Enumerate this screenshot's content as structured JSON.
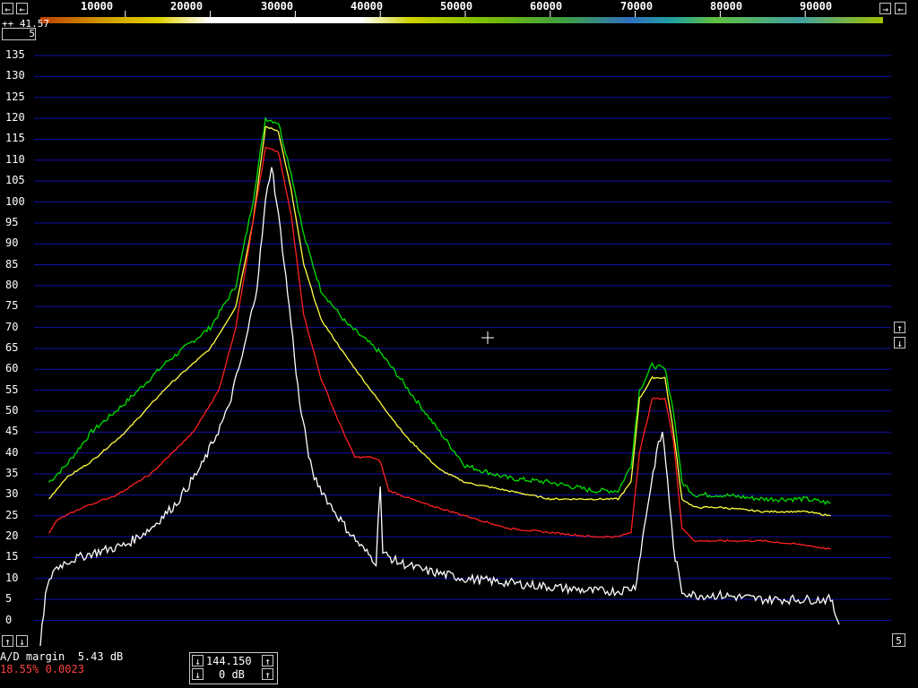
{
  "top_bar": {
    "freq_labels": [
      "10000",
      "20000",
      "30000",
      "40000",
      "50000",
      "60000",
      "70000",
      "80000",
      "90000"
    ],
    "left_arrow": "←",
    "right_arrow": "→"
  },
  "header_small": {
    "readout": "++ 41.57",
    "box": "5"
  },
  "side_controls": {
    "up": "↑",
    "down": "↓",
    "right_box": "5"
  },
  "bottom_left": {
    "ad_margin_label": "A/D margin  5.43 dB",
    "status_red": "18.55% 0.0023"
  },
  "center_box": {
    "freq": "144.150",
    "gain": "0 dB"
  },
  "colors": {
    "green": "#00e000",
    "yellow": "#ffff40",
    "red": "#ff2020",
    "white": "#ffffff",
    "grid": "#1010a8"
  },
  "chart_data": {
    "type": "line",
    "ylim": [
      -5,
      138
    ],
    "xlim": [
      0,
      100000
    ],
    "ylabel": "",
    "xlabel": "",
    "y_ticks": [
      135,
      130,
      125,
      120,
      115,
      110,
      105,
      100,
      95,
      90,
      85,
      80,
      75,
      70,
      65,
      60,
      55,
      50,
      45,
      40,
      35,
      30,
      25,
      20,
      15,
      10,
      5,
      0
    ],
    "x_ticks": [
      10000,
      20000,
      30000,
      40000,
      50000,
      60000,
      70000,
      80000,
      90000
    ],
    "series": [
      {
        "color": "#00e000",
        "x": [
          1000,
          3000,
          6000,
          10000,
          15000,
          20000,
          23000,
          25000,
          26500,
          28000,
          29500,
          31000,
          33000,
          36000,
          40000,
          43000,
          47000,
          50000,
          55000,
          60000,
          65000,
          68000,
          69500,
          70500,
          72000,
          73500,
          74500,
          75500,
          77000,
          80000,
          85000,
          90000,
          93000
        ],
        "y": [
          33,
          37,
          45,
          52,
          62,
          70,
          80,
          100,
          120,
          119,
          107,
          92,
          79,
          71,
          64,
          56,
          45,
          37,
          34,
          33,
          31,
          31,
          37,
          55,
          61,
          60,
          50,
          33,
          30,
          30,
          29,
          29,
          28
        ]
      },
      {
        "color": "#ffff40",
        "x": [
          1000,
          3000,
          6000,
          10000,
          15000,
          20000,
          23000,
          25000,
          26500,
          28000,
          29500,
          31000,
          33000,
          36000,
          40000,
          43000,
          47000,
          50000,
          55000,
          60000,
          65000,
          68000,
          69500,
          70500,
          72000,
          73500,
          74500,
          75500,
          77000,
          80000,
          85000,
          90000,
          93000
        ],
        "y": [
          29,
          34,
          38,
          45,
          56,
          65,
          75,
          95,
          118,
          117,
          103,
          85,
          72,
          63,
          52,
          44,
          36,
          33,
          31,
          29,
          29,
          29,
          33,
          53,
          58,
          58,
          45,
          29,
          27,
          27,
          26,
          26,
          25
        ]
      },
      {
        "color": "#ff2020",
        "x": [
          1000,
          2000,
          5000,
          9000,
          13000,
          18000,
          21000,
          23000,
          25000,
          26500,
          28000,
          29500,
          31000,
          33000,
          35000,
          37000,
          39000,
          40000,
          41000,
          45000,
          50000,
          55000,
          60000,
          65000,
          68000,
          69500,
          70500,
          72000,
          73500,
          74500,
          75500,
          77000,
          80000,
          85000,
          90000,
          93000
        ],
        "y": [
          21,
          24,
          27,
          30,
          35,
          45,
          55,
          70,
          95,
          113,
          112,
          97,
          73,
          58,
          48,
          39,
          39,
          38,
          31,
          28,
          25,
          22,
          21,
          20,
          20,
          21,
          40,
          53,
          53,
          43,
          22,
          19,
          19,
          19,
          18,
          17
        ]
      },
      {
        "color": "#ffffff",
        "x": [
          0,
          600,
          1500,
          3000,
          6000,
          10000,
          13000,
          16000,
          19000,
          22000,
          24000,
          25500,
          26500,
          27200,
          27800,
          28500,
          29500,
          30500,
          32000,
          34000,
          36000,
          38000,
          39500,
          40000,
          40300,
          42000,
          45000,
          50000,
          55000,
          60000,
          65000,
          68000,
          70000,
          71500,
          72500,
          73200,
          73800,
          74500,
          75500,
          77000,
          80000,
          85000,
          90000,
          93000,
          94000
        ],
        "y": [
          -6,
          6,
          12,
          14,
          16,
          18,
          22,
          28,
          37,
          50,
          65,
          80,
          100,
          109,
          100,
          89,
          71,
          52,
          35,
          28,
          22,
          17,
          14,
          33,
          16,
          14,
          12,
          10,
          9,
          8,
          7,
          7,
          8,
          28,
          40,
          45,
          34,
          17,
          7,
          6,
          6,
          5,
          5,
          5,
          -1
        ]
      }
    ]
  }
}
